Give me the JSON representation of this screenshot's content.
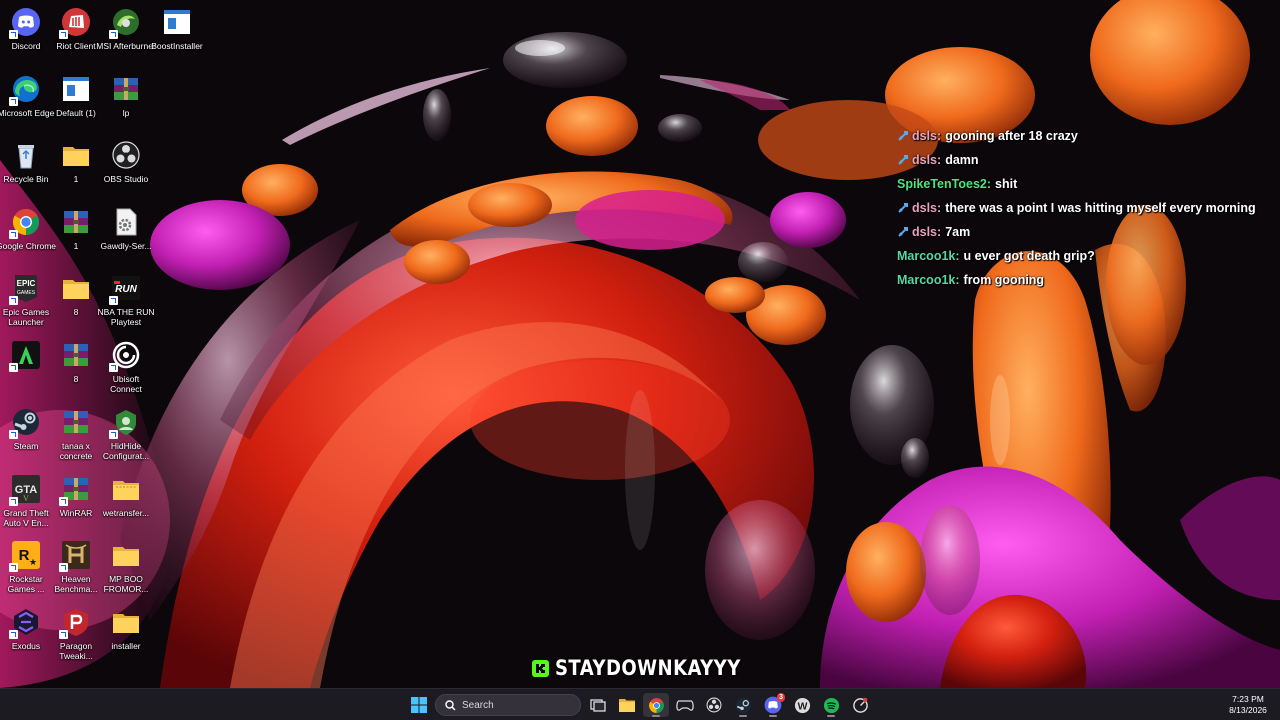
{
  "desktop": {
    "icons": [
      {
        "name": "discord-icon",
        "label": "Discord"
      },
      {
        "name": "riot-client-icon",
        "label": "Riot Client"
      },
      {
        "name": "msi-afterburner-icon",
        "label": "MSI Afterburner"
      },
      {
        "name": "boostinstaller-icon",
        "label": "BoostInstaller"
      },
      {
        "name": "microsoft-edge-icon",
        "label": "Microsoft Edge"
      },
      {
        "name": "default-file-icon",
        "label": "Default (1)"
      },
      {
        "name": "winrar-archive-icon",
        "label": "lp"
      },
      {
        "name": "recycle-bin-icon",
        "label": "Recycle Bin"
      },
      {
        "name": "folder-icon",
        "label": "1"
      },
      {
        "name": "obs-studio-icon",
        "label": "OBS Studio"
      },
      {
        "name": "google-chrome-icon",
        "label": "Google Chrome"
      },
      {
        "name": "winrar-archive-icon",
        "label": "1"
      },
      {
        "name": "gear-file-icon",
        "label": "Gawdly-Ser..."
      },
      {
        "name": "epic-games-icon",
        "label": "Epic Games Launcher"
      },
      {
        "name": "folder-icon",
        "label": "8"
      },
      {
        "name": "nba-the-run-icon",
        "label": "NBA THE RUN Playtest"
      },
      {
        "name": "app-green-icon",
        "label": ""
      },
      {
        "name": "winrar-archive-icon",
        "label": "8"
      },
      {
        "name": "ubisoft-connect-icon",
        "label": "Ubisoft Connect"
      },
      {
        "name": "steam-icon",
        "label": "Steam"
      },
      {
        "name": "winrar-archive-icon",
        "label": "tanaa x concrete"
      },
      {
        "name": "hidhide-icon",
        "label": "HidHide Configurat..."
      },
      {
        "name": "gta-v-icon",
        "label": "Grand Theft Auto V En..."
      },
      {
        "name": "winrar-icon",
        "label": "WinRAR"
      },
      {
        "name": "wetransfer-folder-icon",
        "label": "wetransfer..."
      },
      {
        "name": "rockstar-games-icon",
        "label": "Rockstar Games ..."
      },
      {
        "name": "heaven-benchmark-icon",
        "label": "Heaven Benchma..."
      },
      {
        "name": "folder-icon",
        "label": "MP BOO FROMOR..."
      },
      {
        "name": "exodus-icon",
        "label": "Exodus"
      },
      {
        "name": "paragon-tweaking-icon",
        "label": "Paragon Tweaki..."
      },
      {
        "name": "folder-icon",
        "label": "installer"
      }
    ]
  },
  "chat": {
    "messages": [
      {
        "user": "dsls:",
        "text": "gooning after 18 crazy",
        "color": "#e7a3bb",
        "badge": true
      },
      {
        "user": "dsls:",
        "text": "damn",
        "color": "#e7a3bb",
        "badge": true
      },
      {
        "user": "SpikeTenToes2:",
        "text": "shit",
        "color": "#4fe37d",
        "badge": false
      },
      {
        "user": "dsls:",
        "text": "there was a point I was hitting myself every morning",
        "color": "#e7a3bb",
        "badge": true
      },
      {
        "user": "dsls:",
        "text": "7am",
        "color": "#e7a3bb",
        "badge": true
      },
      {
        "user": "Marcoo1k:",
        "text": "u ever got death grip?",
        "color": "#58d6a6",
        "badge": false
      },
      {
        "user": "Marcoo1k:",
        "text": "from gooning",
        "color": "#58d6a6",
        "badge": false
      }
    ]
  },
  "watermark": {
    "text": "STAYDOWNKAYYY",
    "logo_letter": "K",
    "accent": "#53fc18"
  },
  "taskbar": {
    "search_label": "Search",
    "apps": [
      "start-icon",
      "task-view-icon",
      "file-explorer-icon",
      "chrome-icon",
      "game-controller-icon",
      "obs-icon",
      "steam-icon",
      "discord-icon",
      "wordpad-icon",
      "spotify-icon",
      "app-icon"
    ],
    "discord_badge": "3",
    "clock_time": "7:23 PM",
    "clock_date": "8/13/2026"
  }
}
